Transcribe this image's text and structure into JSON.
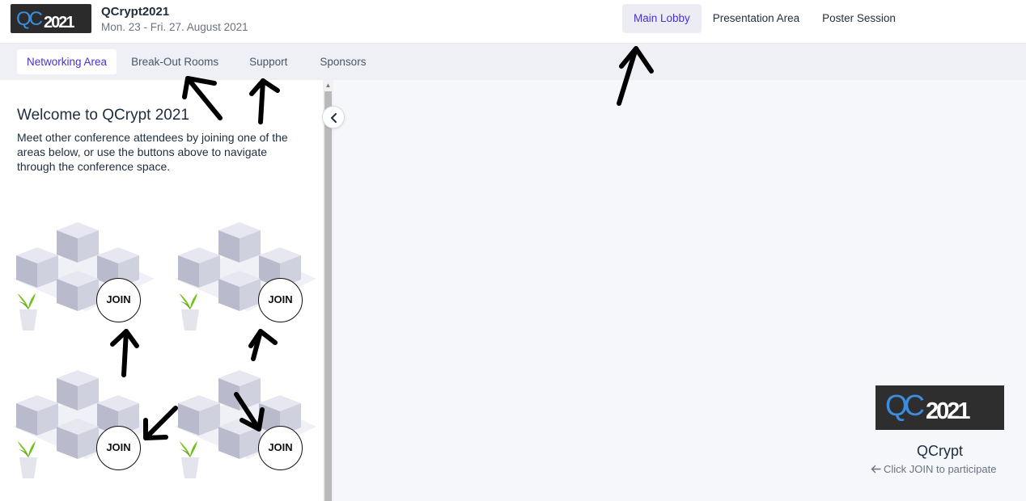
{
  "header": {
    "logo_alt": "QC2021",
    "title": "QCrypt2021",
    "dates": "Mon. 23 - Fri. 27. August 2021",
    "nav": [
      {
        "label": "Main Lobby",
        "active": true
      },
      {
        "label": "Presentation Area",
        "active": false
      },
      {
        "label": "Poster Session",
        "active": false
      }
    ]
  },
  "subnav": {
    "tabs": [
      {
        "label": "Networking Area",
        "active": true
      },
      {
        "label": "Break-Out Rooms",
        "active": false
      },
      {
        "label": "Support",
        "active": false
      },
      {
        "label": "Sponsors",
        "active": false
      }
    ]
  },
  "left_panel": {
    "welcome_title": "Welcome to QCrypt 2021",
    "welcome_text": "Meet other conference attendees by joining one of the areas below, or use the buttons above to navigate through the conference space.",
    "rooms": [
      {
        "join_label": "JOIN"
      },
      {
        "join_label": "JOIN"
      },
      {
        "join_label": "JOIN"
      },
      {
        "join_label": "JOIN"
      }
    ]
  },
  "main": {
    "name": "QCrypt",
    "hint": "Click JOIN to participate",
    "hint_icon": "arrow-left-icon"
  },
  "colors": {
    "accent": "#4b2fd4",
    "logo_blue": "#3b8de0",
    "cube": "#c4c6d6",
    "plant": "#74c01e"
  }
}
